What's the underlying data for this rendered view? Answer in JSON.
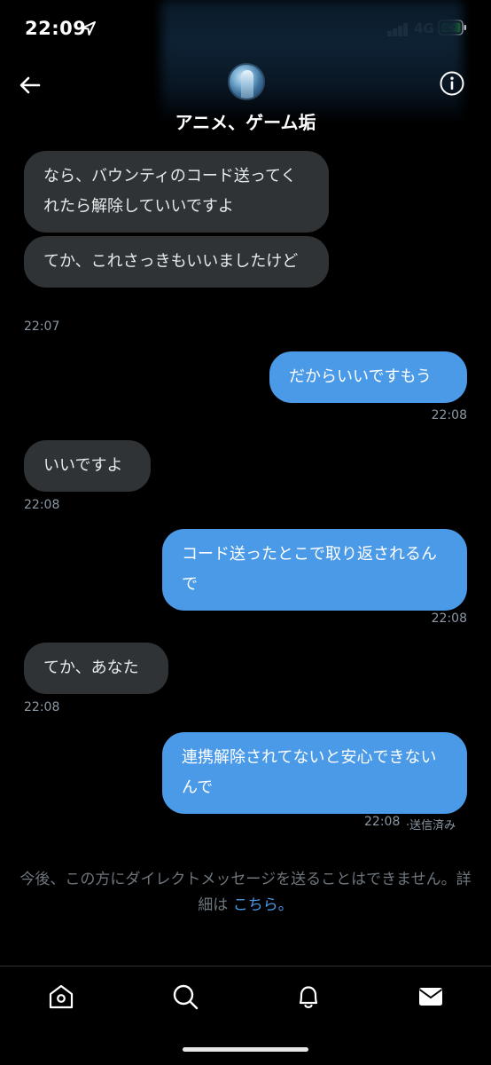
{
  "status_bar": {
    "time": "22:09",
    "network": "4G"
  },
  "header": {
    "title": "アニメ、ゲーム垢"
  },
  "messages": [
    {
      "text": "なら、バウンティのコード送ってくれたら解除していいですよ"
    },
    {
      "text": "てか、これさっきもいいましたけど",
      "time": "22:07"
    },
    {
      "text": "だからいいですもう",
      "time": "22:08"
    },
    {
      "text": "いいですよ",
      "time": "22:08"
    },
    {
      "text": "コード送ったとこで取り返されるんで",
      "time": "22:08"
    },
    {
      "text": "てか、あなた",
      "time": "22:08"
    },
    {
      "text": "連携解除されてないと安心できないんで",
      "time": "22:08",
      "status": "·送信済み"
    }
  ],
  "footer": {
    "notice": "今後、この方にダイレクトメッセージを送ることはできません。詳細は",
    "link": "こちら。"
  }
}
